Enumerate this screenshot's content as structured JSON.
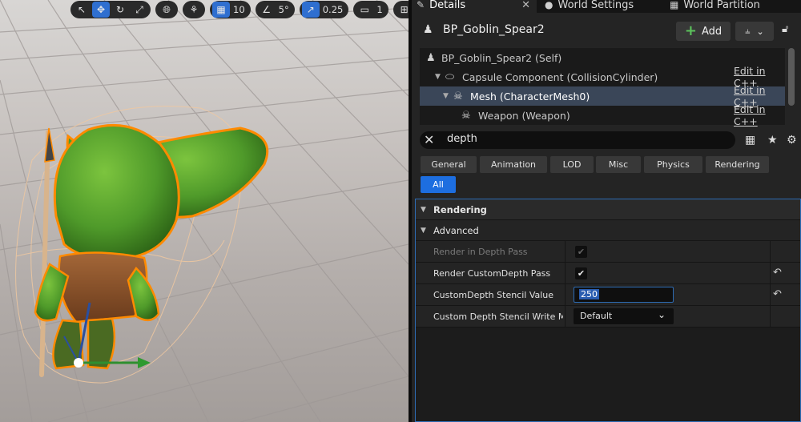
{
  "viewport": {
    "toolbar": {
      "grid_snap_value": "10",
      "rotation_snap_value": "5°",
      "scale_snap_value": "0.25",
      "camera_speed_value": "1"
    }
  },
  "tabs": [
    {
      "label": "Details",
      "icon": "pencil-icon"
    },
    {
      "label": "World Settings",
      "icon": "globe-icon"
    },
    {
      "label": "World Partition",
      "icon": "grid-icon"
    }
  ],
  "actor": {
    "name": "BP_Goblin_Spear2",
    "add_label": "Add"
  },
  "components": [
    {
      "label": "BP_Goblin_Spear2 (Self)",
      "edit": ""
    },
    {
      "label": "Capsule Component (CollisionCylinder)",
      "edit": "Edit in C++"
    },
    {
      "label": "Mesh (CharacterMesh0)",
      "edit": "Edit in C++"
    },
    {
      "label": "Weapon (Weapon)",
      "edit": "Edit in C++"
    }
  ],
  "search": {
    "value": "depth"
  },
  "filters": [
    "General",
    "Animation",
    "LOD",
    "Misc",
    "Physics",
    "Rendering",
    "All"
  ],
  "properties": {
    "category": "Rendering",
    "subcategory": "Advanced",
    "rows": [
      {
        "name": "Render in Depth Pass",
        "checked": true
      },
      {
        "name": "Render CustomDepth Pass",
        "checked": true
      },
      {
        "name": "CustomDepth Stencil Value",
        "value": "250"
      },
      {
        "name": "Custom Depth Stencil Write M...",
        "value": "Default"
      }
    ]
  },
  "colors": {
    "accent": "#1d6ee0",
    "selection": "#3a4658",
    "goblin_skin": "#4f9a2a",
    "outline": "#ff8a00"
  }
}
